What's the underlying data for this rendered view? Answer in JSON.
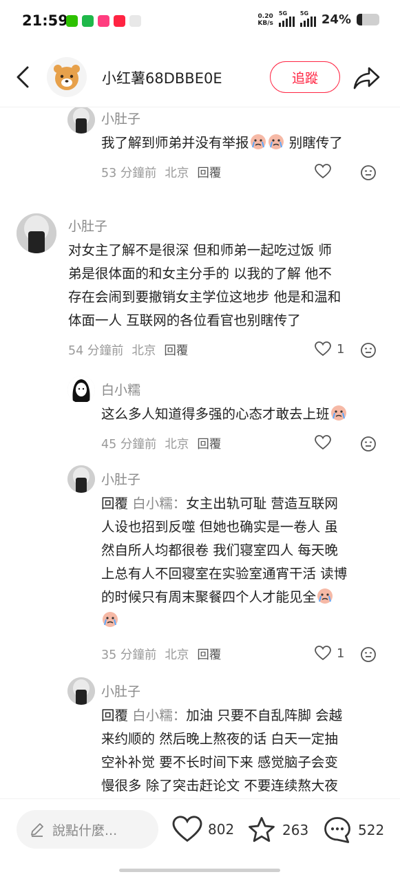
{
  "status_bar": {
    "time": "21:59",
    "net_speed_value": "0.20",
    "net_speed_unit": "KB/s",
    "signal1_label": "5G",
    "signal2_label": "5G",
    "battery_percent": "24%",
    "battery_level": 0.24
  },
  "header": {
    "title": "小红薯68DBBE0E",
    "follow_label": "追蹤"
  },
  "comments": [
    {
      "user": "小肚子",
      "text": "我了解到师弟并没有举报",
      "text_suffix": "别瞎传了",
      "time": "53 分鐘前",
      "location": "北京",
      "reply_label": "回覆",
      "likes": ""
    },
    {
      "user": "小肚子",
      "lines": [
        "对女主了解不是很深 但和师弟一起吃过饭 师",
        "弟是很体面的和女主分手的 以我的了解 他不",
        "存在会闹到要撤销女主学位这地步 他是和温和",
        "体面一人 互联网的各位看官也别瞎传了"
      ],
      "time": "54 分鐘前",
      "location": "北京",
      "reply_label": "回覆",
      "likes": "1"
    },
    {
      "user": "白小糯",
      "text": "这么多人知道得多强的心态才敢去上班",
      "time": "45 分鐘前",
      "location": "北京",
      "reply_label": "回覆",
      "likes": ""
    },
    {
      "user": "小肚子",
      "reply_prefix": "回覆",
      "reply_target": "白小糯：",
      "lines": [
        "女主出轨可耻 营造互联网",
        "人设也招到反噬 但她也确实是一卷人 虽",
        "然自所人均都很卷 我们寝室四人 每天晚",
        "上总有人不回寝室在实验室通宵干活 读博",
        "的时候只有周末聚餐四个人才能见全"
      ],
      "time": "35 分鐘前",
      "location": "北京",
      "reply_label": "回覆",
      "likes": "1"
    },
    {
      "user": "小肚子",
      "reply_prefix": "回覆",
      "reply_target": "白小糯：",
      "lines": [
        "加油 只要不自乱阵脚 会越",
        "来约顺的 然后晚上熬夜的话 白天一定抽",
        "空补补觉 要不长时间下来 感觉脑子会变",
        "慢很多 除了突击赶论文 不要连续熬大夜"
      ]
    }
  ],
  "bottom_bar": {
    "input_placeholder": "說點什麼...",
    "likes_count": "802",
    "collects_count": "263",
    "comments_count": "522"
  },
  "colors": {
    "accent": "#ff2442",
    "muted": "#8a8a8a"
  }
}
